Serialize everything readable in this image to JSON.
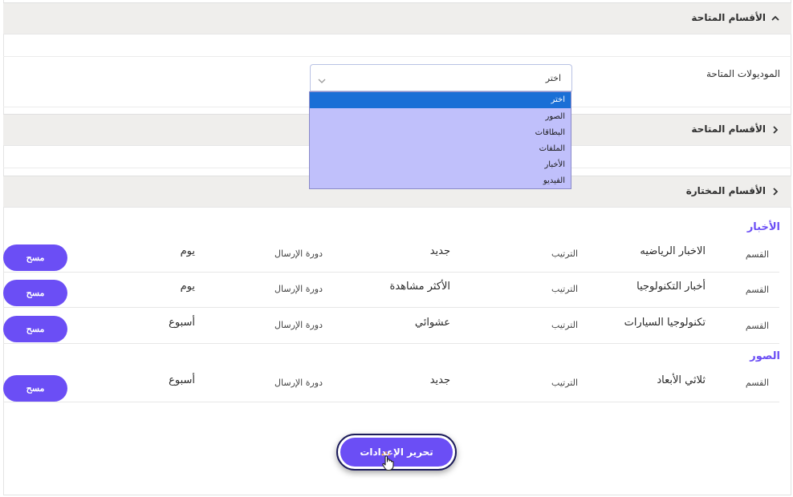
{
  "sections": {
    "available_top": {
      "title": "الأقسام المتاحة",
      "expanded": true
    },
    "available_second": {
      "title": "الأقسام المتاحة",
      "expanded": false
    },
    "selected": {
      "title": "الأقسام المختارة",
      "expanded": true
    }
  },
  "modules_field": {
    "label": "الموديولات المتاحة",
    "selected_value": "اختر",
    "options": [
      "اختر",
      "الصور",
      "البطاقات",
      "الملفات",
      "الأخبار",
      "الفيديو"
    ]
  },
  "groups": [
    {
      "title": "الأخبار",
      "rows": [
        {
          "section_label": "القسم",
          "section_value": "الاخبار الرياضيه",
          "order_label": "الترتيب",
          "order_value": "جديد",
          "cycle_label": "دورة الإرسال",
          "cycle_value": "يوم",
          "delete_label": "مسح"
        },
        {
          "section_label": "القسم",
          "section_value": "أخبار التكنولوجيا",
          "order_label": "الترتيب",
          "order_value": "الأكثر مشاهدة",
          "cycle_label": "دورة الإرسال",
          "cycle_value": "يوم",
          "delete_label": "مسح"
        },
        {
          "section_label": "القسم",
          "section_value": "تكنولوجيا السيارات",
          "order_label": "الترتيب",
          "order_value": "عشوائي",
          "cycle_label": "دورة الإرسال",
          "cycle_value": "أسبوع",
          "delete_label": "مسح"
        }
      ]
    },
    {
      "title": "الصور",
      "rows": [
        {
          "section_label": "القسم",
          "section_value": "ثلاثي الأبعاد",
          "order_label": "الترتيب",
          "order_value": "جديد",
          "cycle_label": "دورة الإرسال",
          "cycle_value": "أسبوع",
          "delete_label": "مسح"
        }
      ]
    }
  ],
  "edit_button": {
    "label": "تحرير الإعدادات"
  },
  "colors": {
    "accent": "#6b4ef5",
    "dropdown_bg": "#c0c0fb",
    "selected_option": "#1a6fd6",
    "header_bg": "#efeeec"
  },
  "icons": {
    "expanded": "chevron-up-icon",
    "collapsed": "chevron-right-icon",
    "select_arrow": "chevron-down-icon",
    "cursor": "hand-pointer-icon"
  }
}
